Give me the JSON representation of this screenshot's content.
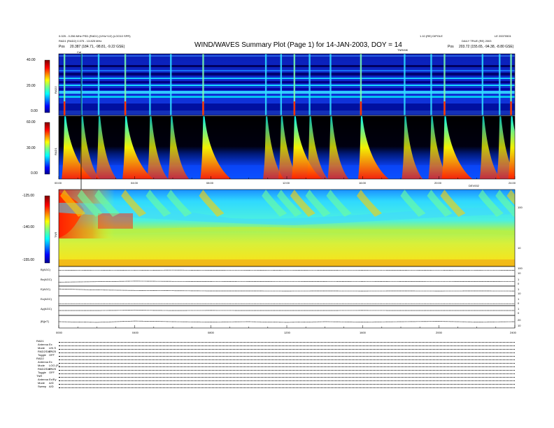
{
  "header": {
    "left_line1": "0.025 - 0.256 MHz PSD (RAD1) (V/Hz^1/2) (LOG10 SPR)",
    "left_line2": "RAD1 (RAD2) 0.075 - 13.825 MHz",
    "left_pos_label": "Pos",
    "left_pos_value": "20.387 (184.71, -98.81, -9.22 GSE)",
    "title": "WIND/WAVES Summary Plot (Page 1) for 14-JAN-2003, DOY = 14",
    "right_line1": "1.10 (RE) DIPOLE",
    "right_line2": "LE 20070501",
    "right_line3": "DAILY TRUE (RE) 2003",
    "right_pos_label": "Pos",
    "right_pos_value": "203.72 (155.65, -94.38, -8.80 GSE)",
    "marker_label": "Cal",
    "tnr_tag": "TNR/MK"
  },
  "panels": {
    "rad2": {
      "label": "RAD2",
      "ticks": [
        "40.00",
        "20.00",
        "0.00"
      ]
    },
    "rad1": {
      "label": "RAD1",
      "ticks": [
        "60.00",
        "30.00",
        "0.00"
      ]
    },
    "tnr": {
      "label": "TNR",
      "ticks": [
        "-125.00",
        "-140.00",
        "-155.00"
      ],
      "right_ticks": [
        "100",
        "10"
      ]
    },
    "rad_time_ticks": [
      "00:00",
      "04:00",
      "08:00",
      "12:00",
      "16:00",
      "20:00",
      "24:00"
    ],
    "rad_time_extra": "DEV002"
  },
  "lines": {
    "labels": [
      "B(AGC)",
      "Bx(AGC)",
      "E(AGC)",
      "Ez(AGC)",
      "Ay(AGC)",
      "|B|(nT)"
    ],
    "right_ticks": [
      [
        "100",
        "10"
      ],
      [
        "1",
        "0"
      ],
      [
        "1",
        "10"
      ],
      [
        "1",
        "0"
      ],
      [
        "1",
        "0"
      ],
      [
        "20",
        "10"
      ]
    ],
    "time_ticks": [
      "0000",
      "0400",
      "0800",
      "1200",
      "1600",
      "2000",
      "2400"
    ]
  },
  "footer": {
    "sections": [
      {
        "title": "RAD1",
        "rows": [
          [
            "Antenna",
            "Ex"
          ],
          [
            "Mode",
            "LIN S"
          ],
          [
            "RAD2/DAP",
            "0.425"
          ],
          [
            "Toggle",
            "OFF"
          ]
        ]
      },
      {
        "title": "RAD2",
        "rows": [
          [
            "Antenna",
            "Ex"
          ],
          [
            "Mode",
            "LOG (F)"
          ],
          [
            "RAD2/DAP",
            "0.425"
          ],
          [
            "Toggle",
            "OFF"
          ]
        ]
      },
      {
        "title": "TNR",
        "rows": [
          [
            "Antenna",
            "Ex/Ey"
          ],
          [
            "Mode",
            "A/D"
          ],
          [
            "Sweep",
            "A/D"
          ]
        ]
      }
    ]
  },
  "chart_data": {
    "type": "heatmap",
    "title": "WIND/WAVES Summary Plot (Page 1) for 14-JAN-2003, DOY = 14",
    "xlabel": "",
    "ylabel": "",
    "x_range_hours": [
      0,
      24
    ],
    "panels": [
      {
        "name": "RAD2",
        "ylim": [
          0,
          40
        ],
        "colorscale": "jet"
      },
      {
        "name": "RAD1",
        "ylim": [
          0,
          60
        ],
        "colorscale": "jet"
      },
      {
        "name": "TNR",
        "ylim": [
          -155,
          -125
        ],
        "colorscale": "jet"
      }
    ],
    "type_III_burst_times_hours": [
      0.3,
      1.2,
      2.1,
      3.5,
      4.8,
      5.9,
      7.6,
      10.9,
      11.7,
      12.4,
      13.2,
      14.3,
      15.9,
      18.2,
      19.6,
      20.3,
      22.3,
      23.2,
      23.8
    ],
    "time_series": [
      {
        "name": "B(AGC)",
        "values": [
          0.6,
          0.62,
          0.6,
          0.63,
          0.61,
          0.6,
          0.62,
          0.61,
          0.6,
          0.61,
          0.62,
          0.6,
          0.61
        ]
      },
      {
        "name": "Bx(AGC)",
        "values": [
          0.4,
          0.45,
          0.5,
          0.48,
          0.47,
          0.46,
          0.45,
          0.46,
          0.47,
          0.46,
          0.45,
          0.46,
          0.45
        ]
      },
      {
        "name": "E(AGC)",
        "values": [
          0.7,
          0.6,
          0.55,
          0.52,
          0.5,
          0.5,
          0.49,
          0.5,
          0.49,
          0.5,
          0.49,
          0.5,
          0.49
        ]
      },
      {
        "name": "Ez(AGC)",
        "values": [
          0.2,
          0.2,
          0.2,
          0.2,
          0.2,
          0.2,
          0.2,
          0.2,
          0.2,
          0.2,
          0.2,
          0.2,
          0.2
        ]
      },
      {
        "name": "Ay(AGC)",
        "values": [
          0.5,
          0.5,
          0.52,
          0.5,
          0.51,
          0.5,
          0.5,
          0.5,
          0.51,
          0.5,
          0.5,
          0.5,
          0.5
        ]
      },
      {
        "name": "|B|(nT)",
        "values": [
          0.5,
          0.45,
          0.55,
          0.5,
          0.48,
          0.5,
          0.45,
          0.5,
          0.48,
          0.5,
          0.52,
          0.48,
          0.5
        ]
      }
    ]
  }
}
